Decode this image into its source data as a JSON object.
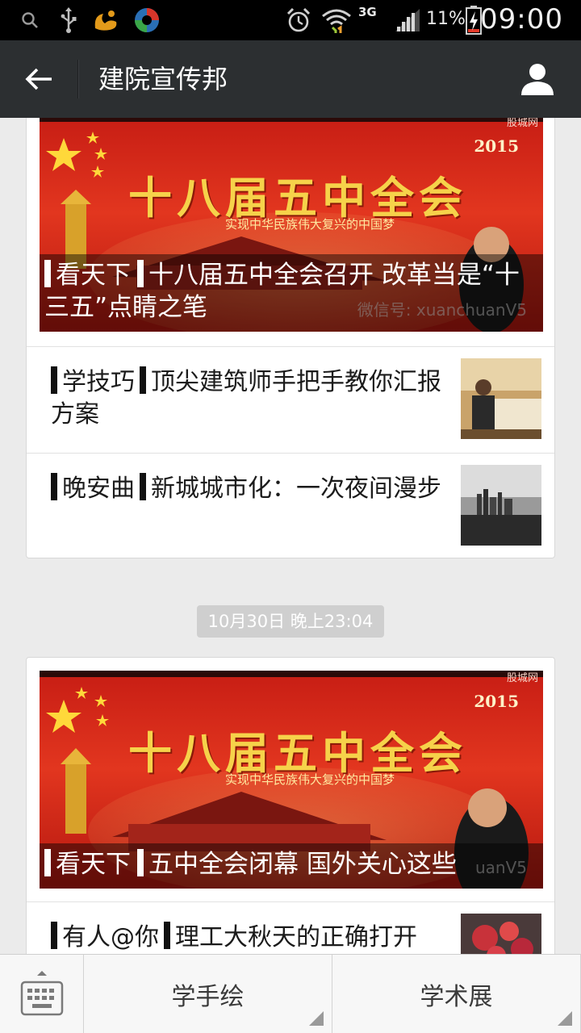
{
  "status_bar": {
    "network": "3G",
    "battery_percent": "11%",
    "time": "09:00",
    "icons": [
      "search-icon",
      "usb-icon",
      "uc-browser-icon",
      "app-icon",
      "alarm-icon",
      "wifi-icon",
      "signal-icon",
      "battery-icon"
    ]
  },
  "app_bar": {
    "title": "建院宣传邦",
    "back_icon": "back-arrow-icon",
    "profile_icon": "user-profile-icon"
  },
  "feed": {
    "group1": {
      "hero": {
        "image_banner": "十八届五中全会",
        "image_subtitle": "实现中华民族伟大复兴的中国梦",
        "image_year": "2015",
        "image_watermark": "股城网",
        "tag": "看天下",
        "title": "十八届五中全会召开 改革当是“十三五”点睛之笔",
        "wechat_watermark": "微信号: xuanchuanV5"
      },
      "items": [
        {
          "tag": "学技巧",
          "title": "顶尖建筑师手把手教你汇报方案",
          "thumb_icon": "architect-photo"
        },
        {
          "tag": "晚安曲",
          "title": "新城城市化：一次夜间漫步",
          "thumb_icon": "city-night-photo"
        }
      ]
    },
    "timestamp": "10月30日 晚上23:04",
    "group2": {
      "hero": {
        "image_banner": "十八届五中全会",
        "image_subtitle": "实现中华民族伟大复兴的中国梦",
        "image_year": "2015",
        "image_watermark": "股城网",
        "tag": "看天下",
        "title": "五中全会闭幕 国外关心这些",
        "wechat_watermark": "uanV5"
      },
      "items": [
        {
          "tag": "有人@你",
          "title": "理工大秋天的正确打开",
          "thumb_icon": "autumn-leaves-photo"
        }
      ]
    }
  },
  "bottom_menu": {
    "keyboard_icon": "keyboard-icon",
    "items": [
      "学手绘",
      "学术展"
    ],
    "colors": {
      "menu_text": "#3a3a3a",
      "app_bar": "#2c2f31"
    }
  }
}
